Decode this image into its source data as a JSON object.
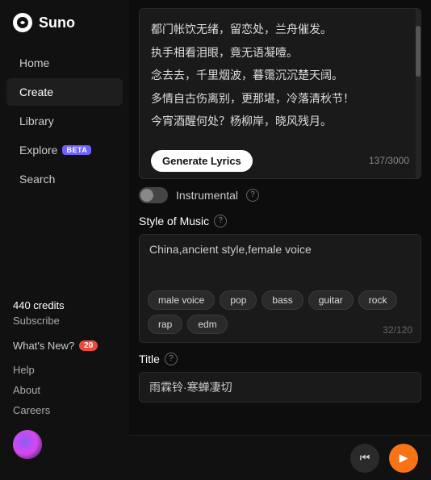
{
  "logo": {
    "icon": "◎",
    "text": "Suno"
  },
  "nav": {
    "items": [
      {
        "id": "home",
        "label": "Home",
        "active": false
      },
      {
        "id": "create",
        "label": "Create",
        "active": true
      },
      {
        "id": "library",
        "label": "Library",
        "active": false
      },
      {
        "id": "explore",
        "label": "Explore",
        "active": false,
        "badge": "BETA"
      },
      {
        "id": "search",
        "label": "Search",
        "active": false
      }
    ],
    "credits": "440 credits",
    "subscribe": "Subscribe",
    "whats_new": "What's New?",
    "whats_new_count": "20",
    "help": "Help",
    "about": "About",
    "careers": "Careers"
  },
  "lyrics": {
    "lines": [
      "都门帐饮无绪，留恋处，兰舟催发。",
      "执手相看泪眼，竟无语凝噎。",
      "念去去，千里烟波，暮霭沉沉楚天阔。",
      "多情自古伤离别，更那堪，冷落清秋节！",
      "今宵酒醒何处？杨柳岸，晓风残月。"
    ],
    "generate_button": "Generate Lyrics",
    "char_count": "137/3000"
  },
  "instrumental": {
    "label": "Instrumental",
    "enabled": false
  },
  "style_of_music": {
    "label": "Style of Music",
    "value": "China,ancient style,female voice",
    "char_count": "32/120",
    "tags": [
      {
        "id": "male-voice",
        "label": "male voice"
      },
      {
        "id": "pop",
        "label": "pop"
      },
      {
        "id": "bass",
        "label": "bass"
      },
      {
        "id": "guitar",
        "label": "guitar"
      },
      {
        "id": "rock",
        "label": "rock"
      },
      {
        "id": "rap",
        "label": "rap"
      },
      {
        "id": "edm",
        "label": "edm"
      }
    ]
  },
  "title": {
    "label": "Title",
    "value": "雨霖铃·寒蝉凄切"
  },
  "player": {
    "skip_icon": "⏮",
    "play_icon": "▶"
  }
}
